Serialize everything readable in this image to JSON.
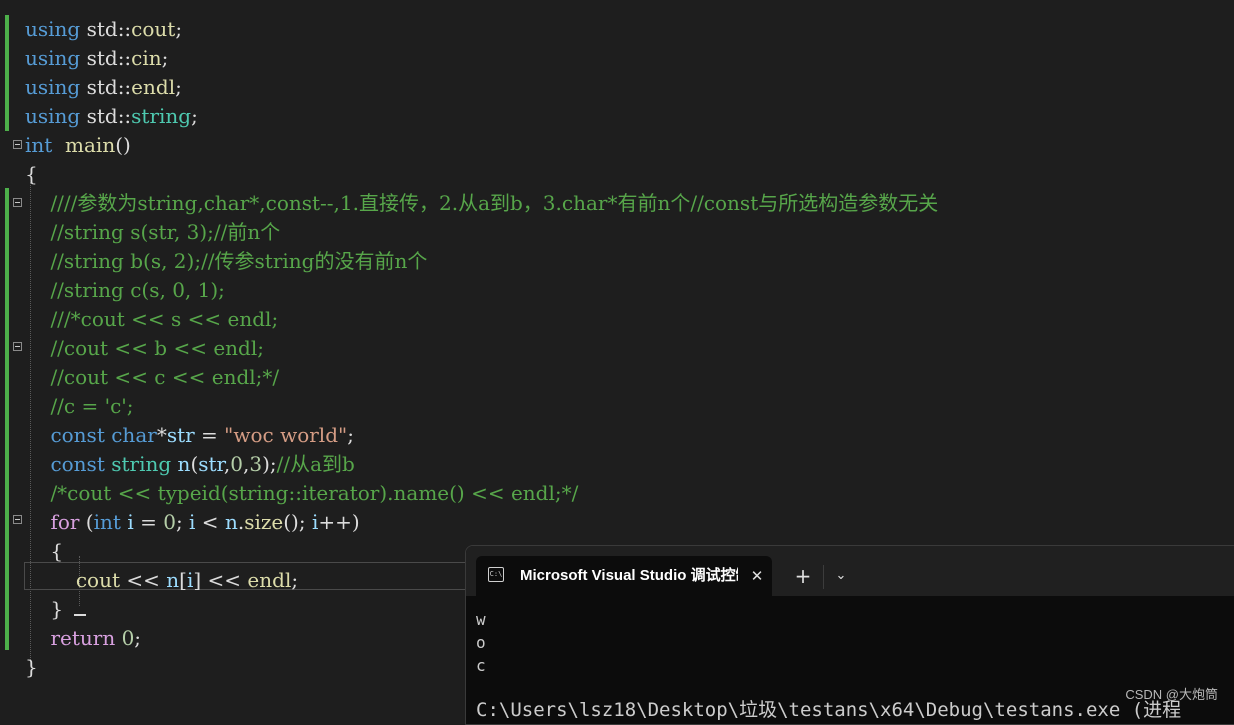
{
  "editor": {
    "lines": [
      {
        "segments": [
          {
            "c": "kw",
            "t": "using"
          },
          {
            "c": "",
            "t": " std::"
          },
          {
            "c": "fn",
            "t": "cout"
          },
          {
            "c": "",
            "t": ";"
          }
        ]
      },
      {
        "segments": [
          {
            "c": "kw",
            "t": "using"
          },
          {
            "c": "",
            "t": " std::"
          },
          {
            "c": "fn",
            "t": "cin"
          },
          {
            "c": "",
            "t": ";"
          }
        ]
      },
      {
        "segments": [
          {
            "c": "kw",
            "t": "using"
          },
          {
            "c": "",
            "t": " std::"
          },
          {
            "c": "fn",
            "t": "endl"
          },
          {
            "c": "",
            "t": ";"
          }
        ]
      },
      {
        "segments": [
          {
            "c": "kw",
            "t": "using"
          },
          {
            "c": "",
            "t": " std::"
          },
          {
            "c": "tp",
            "t": "string"
          },
          {
            "c": "",
            "t": ";"
          }
        ]
      },
      {
        "segments": [
          {
            "c": "kw",
            "t": "int"
          },
          {
            "c": "",
            "t": "  "
          },
          {
            "c": "fn",
            "t": "main"
          },
          {
            "c": "",
            "t": "()"
          }
        ]
      },
      {
        "segments": [
          {
            "c": "",
            "t": "{"
          }
        ]
      },
      {
        "segments": [
          {
            "c": "",
            "t": "    "
          },
          {
            "c": "cm",
            "t": "////参数为string,char*,const--,1.直接传，2.从a到b，3.char*有前n个//const与所选构造参数无关"
          }
        ]
      },
      {
        "segments": [
          {
            "c": "",
            "t": "    "
          },
          {
            "c": "cm",
            "t": "//string s(str, 3);//前n个"
          }
        ]
      },
      {
        "segments": [
          {
            "c": "",
            "t": "    "
          },
          {
            "c": "cm",
            "t": "//string b(s, 2);//传参string的没有前n个"
          }
        ]
      },
      {
        "segments": [
          {
            "c": "",
            "t": "    "
          },
          {
            "c": "cm",
            "t": "//string c(s, 0, 1);"
          }
        ]
      },
      {
        "segments": [
          {
            "c": "",
            "t": "    "
          },
          {
            "c": "cm",
            "t": "///*cout << s << endl;"
          }
        ]
      },
      {
        "segments": [
          {
            "c": "",
            "t": "    "
          },
          {
            "c": "cm",
            "t": "//cout << b << endl;"
          }
        ]
      },
      {
        "segments": [
          {
            "c": "",
            "t": "    "
          },
          {
            "c": "cm",
            "t": "//cout << c << endl;*/"
          }
        ]
      },
      {
        "segments": [
          {
            "c": "",
            "t": "    "
          },
          {
            "c": "cm",
            "t": "//c = 'c';"
          }
        ]
      },
      {
        "segments": [
          {
            "c": "",
            "t": "    "
          },
          {
            "c": "kw",
            "t": "const"
          },
          {
            "c": "",
            "t": " "
          },
          {
            "c": "kw",
            "t": "char"
          },
          {
            "c": "",
            "t": "*"
          },
          {
            "c": "vr",
            "t": "str"
          },
          {
            "c": "",
            "t": " = "
          },
          {
            "c": "st",
            "t": "\"woc world\""
          },
          {
            "c": "",
            "t": ";"
          }
        ]
      },
      {
        "segments": [
          {
            "c": "",
            "t": "    "
          },
          {
            "c": "kw",
            "t": "const"
          },
          {
            "c": "",
            "t": " "
          },
          {
            "c": "tp",
            "t": "string"
          },
          {
            "c": "",
            "t": " "
          },
          {
            "c": "vr",
            "t": "n"
          },
          {
            "c": "",
            "t": "("
          },
          {
            "c": "vr",
            "t": "str"
          },
          {
            "c": "",
            "t": ","
          },
          {
            "c": "nm",
            "t": "0"
          },
          {
            "c": "",
            "t": ","
          },
          {
            "c": "nm",
            "t": "3"
          },
          {
            "c": "",
            "t": ");"
          },
          {
            "c": "cm",
            "t": "//从a到b"
          }
        ]
      },
      {
        "segments": [
          {
            "c": "",
            "t": "    "
          },
          {
            "c": "cm",
            "t": "/*cout << typeid(string::iterator).name() << endl;*/"
          }
        ]
      },
      {
        "segments": [
          {
            "c": "",
            "t": "    "
          },
          {
            "c": "ct",
            "t": "for"
          },
          {
            "c": "",
            "t": " ("
          },
          {
            "c": "kw",
            "t": "int"
          },
          {
            "c": "",
            "t": " "
          },
          {
            "c": "vr",
            "t": "i"
          },
          {
            "c": "",
            "t": " = "
          },
          {
            "c": "nm",
            "t": "0"
          },
          {
            "c": "",
            "t": "; "
          },
          {
            "c": "vr",
            "t": "i"
          },
          {
            "c": "",
            "t": " < "
          },
          {
            "c": "vr",
            "t": "n"
          },
          {
            "c": "",
            "t": "."
          },
          {
            "c": "fn",
            "t": "size"
          },
          {
            "c": "",
            "t": "(); "
          },
          {
            "c": "vr",
            "t": "i"
          },
          {
            "c": "",
            "t": "++)"
          }
        ]
      },
      {
        "segments": [
          {
            "c": "",
            "t": "    {"
          }
        ]
      },
      {
        "segments": [
          {
            "c": "",
            "t": "        "
          },
          {
            "c": "fn",
            "t": "cout"
          },
          {
            "c": "",
            "t": " << "
          },
          {
            "c": "vr",
            "t": "n"
          },
          {
            "c": "",
            "t": "["
          },
          {
            "c": "vr",
            "t": "i"
          },
          {
            "c": "",
            "t": "] << "
          },
          {
            "c": "fn",
            "t": "endl"
          },
          {
            "c": "",
            "t": ";"
          }
        ]
      },
      {
        "segments": [
          {
            "c": "",
            "t": "    }"
          }
        ]
      },
      {
        "segments": [
          {
            "c": "",
            "t": "    "
          },
          {
            "c": "ct",
            "t": "return"
          },
          {
            "c": "",
            "t": " "
          },
          {
            "c": "nm",
            "t": "0"
          },
          {
            "c": "",
            "t": ";"
          }
        ]
      },
      {
        "segments": [
          {
            "c": "",
            "t": "}"
          }
        ]
      }
    ]
  },
  "terminal": {
    "icon_text": "C:\\",
    "tab_title": "Microsoft Visual Studio 调试控制台",
    "close_glyph": "✕",
    "new_tab_glyph": "+",
    "dropdown_glyph": "⌄",
    "output": [
      "w",
      "o",
      "c"
    ],
    "path_line": "C:\\Users\\lsz18\\Desktop\\垃圾\\testans\\x64\\Debug\\testans.exe (进程"
  },
  "watermark": "CSDN @大炮筒"
}
